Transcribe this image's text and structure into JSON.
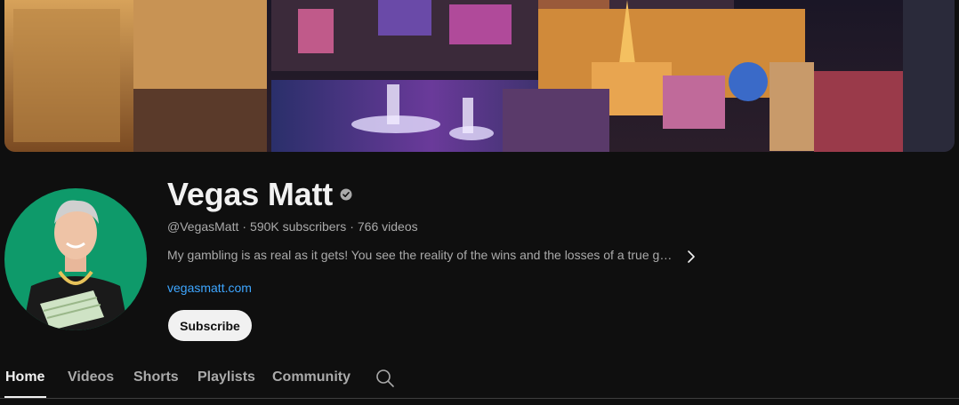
{
  "channel": {
    "name": "Vegas Matt",
    "handle": "@VegasMatt",
    "subscribers": "590K subscribers",
    "videos": "766 videos",
    "separator": "·",
    "description": "My gambling is as real as it gets! You see the reality of the wins and the losses of a true ga…",
    "link": "vegasmatt.com",
    "subscribe_label": "Subscribe",
    "verified": true
  },
  "tabs": [
    {
      "label": "Home",
      "active": true
    },
    {
      "label": "Videos",
      "active": false
    },
    {
      "label": "Shorts",
      "active": false
    },
    {
      "label": "Playlists",
      "active": false
    },
    {
      "label": "Community",
      "active": false
    }
  ],
  "icons": {
    "verified": "verified-check-icon",
    "more": "chevron-right-icon",
    "search": "search-icon"
  },
  "colors": {
    "background": "#0f0f0f",
    "text_primary": "#f1f1f1",
    "text_secondary": "#aaaaaa",
    "link": "#3ea6ff",
    "avatar_bg": "#0e9a6a"
  }
}
